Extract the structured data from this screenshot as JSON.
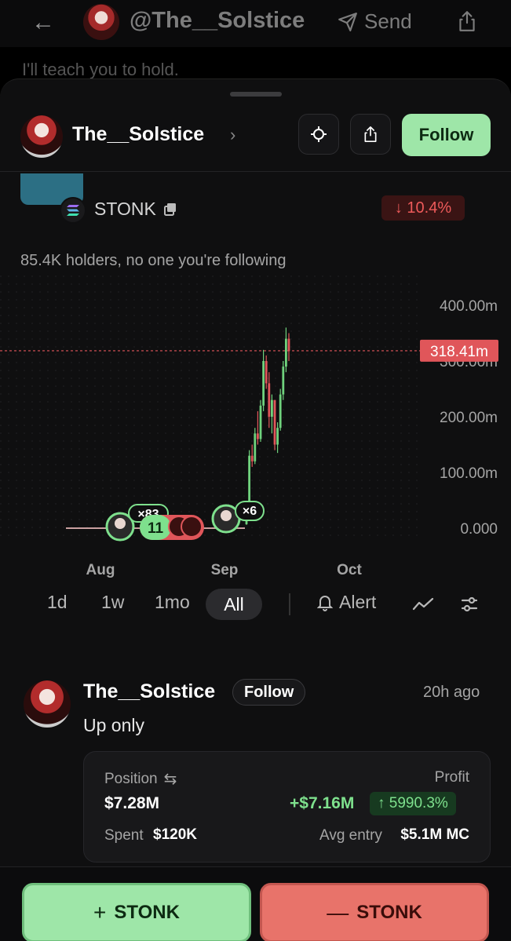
{
  "top_bar": {
    "handle": "@The__Solstice",
    "send_label": "Send",
    "background_text": "I'll teach you to hold."
  },
  "header": {
    "name": "The__Solstice",
    "follow_label": "Follow"
  },
  "token": {
    "symbol": "STONK",
    "change": "10.4%",
    "holders_text": "85.4K holders, no one you're following"
  },
  "chart": {
    "price_label": "318.41m",
    "y_ticks": [
      "400.00m",
      "300.00m",
      "200.00m",
      "100.00m",
      "0.000"
    ],
    "x_ticks": [
      "Aug",
      "Sep",
      "Oct"
    ],
    "markers": {
      "group_count": "×83",
      "badge_number": "11",
      "single_count": "×6"
    },
    "colors": {
      "up": "#6fd27d",
      "down": "#e0565a",
      "price_line": "#e0565a"
    }
  },
  "chart_data": {
    "type": "candlestick",
    "y_unit": "m",
    "ylim": [
      0,
      400
    ],
    "y_ticks": [
      400,
      300,
      200,
      100,
      0
    ],
    "x_ticks": [
      "Aug",
      "Sep",
      "Oct"
    ],
    "current_value": 318.41,
    "candles_approx": [
      {
        "open": 0,
        "high": 2,
        "low": 0,
        "close": 1
      },
      {
        "open": 1,
        "high": 2,
        "low": 0,
        "close": 1
      },
      {
        "open": 1,
        "high": 3,
        "low": 0,
        "close": 2
      },
      {
        "open": 2,
        "high": 3,
        "low": 0,
        "close": 1
      },
      {
        "open": 1,
        "high": 3,
        "low": 1,
        "close": 2
      },
      {
        "open": 2,
        "high": 4,
        "low": 1,
        "close": 3
      },
      {
        "open": 3,
        "high": 5,
        "low": 2,
        "close": 4
      },
      {
        "open": 4,
        "high": 6,
        "low": 3,
        "close": 5
      },
      {
        "open": 5,
        "high": 8,
        "low": 4,
        "close": 7
      },
      {
        "open": 7,
        "high": 40,
        "low": 6,
        "close": 30
      },
      {
        "open": 30,
        "high": 140,
        "low": 25,
        "close": 130
      },
      {
        "open": 130,
        "high": 150,
        "low": 110,
        "close": 120
      },
      {
        "open": 120,
        "high": 180,
        "low": 115,
        "close": 170
      },
      {
        "open": 170,
        "high": 210,
        "low": 150,
        "close": 160
      },
      {
        "open": 160,
        "high": 230,
        "low": 155,
        "close": 220
      },
      {
        "open": 220,
        "high": 320,
        "low": 210,
        "close": 300
      },
      {
        "open": 300,
        "high": 310,
        "low": 250,
        "close": 260
      },
      {
        "open": 260,
        "high": 280,
        "low": 180,
        "close": 200
      },
      {
        "open": 200,
        "high": 240,
        "low": 170,
        "close": 230
      },
      {
        "open": 230,
        "high": 220,
        "low": 140,
        "close": 150
      },
      {
        "open": 150,
        "high": 190,
        "low": 135,
        "close": 180
      },
      {
        "open": 180,
        "high": 250,
        "low": 175,
        "close": 240
      },
      {
        "open": 240,
        "high": 300,
        "low": 230,
        "close": 290
      },
      {
        "open": 290,
        "high": 360,
        "low": 280,
        "close": 340
      },
      {
        "open": 340,
        "high": 350,
        "low": 300,
        "close": 318
      }
    ]
  },
  "ranges": {
    "options": [
      "1d",
      "1w",
      "1mo",
      "All"
    ],
    "selected": "All",
    "alert_label": "Alert"
  },
  "post": {
    "author": "The__Solstice",
    "follow_label": "Follow",
    "time": "20h ago",
    "text": "Up only",
    "position_label": "Position",
    "position_value": "$7.28M",
    "profit_label": "Profit",
    "profit_value": "+$7.16M",
    "profit_pct": "5990.3%",
    "spent_label": "Spent",
    "spent_value": "$120K",
    "avg_entry_label": "Avg entry",
    "avg_entry_value": "$5.1M MC"
  },
  "actions": {
    "buy_label": "STONK",
    "sell_label": "STONK"
  },
  "icons": [
    "back-arrow-icon",
    "send-icon",
    "share-icon",
    "chevron-right-icon",
    "crosshair-icon",
    "solana-icon",
    "copy-icon",
    "arrow-down-icon",
    "arrow-up-icon",
    "swap-icon",
    "bell-icon",
    "line-chart-icon",
    "sliders-icon",
    "plus-icon",
    "minus-icon"
  ]
}
